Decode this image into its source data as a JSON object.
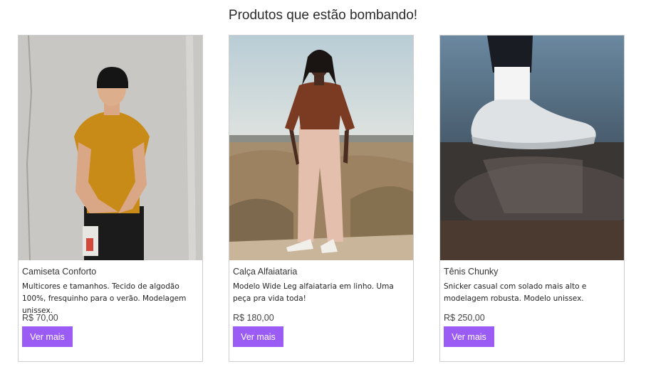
{
  "section": {
    "title": "Produtos que estão bombando!"
  },
  "accent_color": "#9b5cf6",
  "products": [
    {
      "name": "Camiseta Conforto",
      "description": "Multicores e tamanhos. Tecido de algodão 100%, fresquinho para o verão. Modelagem unissex.",
      "price": "R$ 70,00",
      "button_label": "Ver mais"
    },
    {
      "name": "Calça Alfaiataria",
      "description": "Modelo Wide Leg alfaiataria em linho. Uma peça pra vida toda!",
      "price": "R$ 180,00",
      "button_label": "Ver mais"
    },
    {
      "name": "Tênis Chunky",
      "description": "Snicker casual com solado mais alto e modelagem robusta. Modelo unissex.",
      "price": "R$ 250,00",
      "button_label": "Ver mais"
    }
  ]
}
